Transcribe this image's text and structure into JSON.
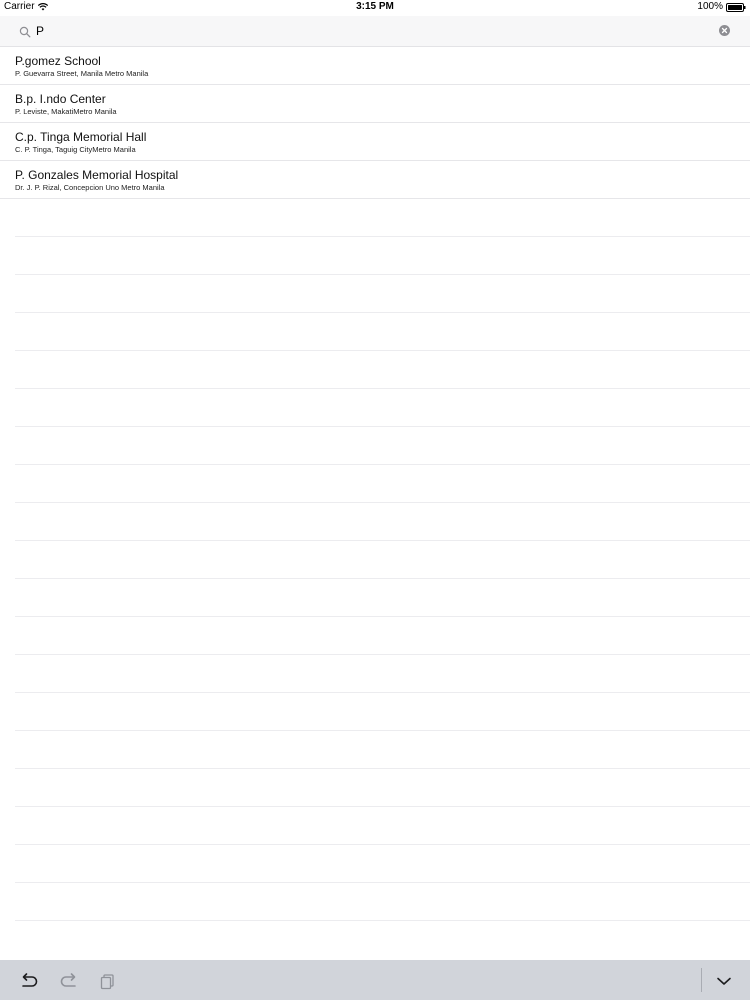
{
  "status_bar": {
    "carrier": "Carrier",
    "time": "3:15 PM",
    "battery": "100%"
  },
  "search": {
    "value": "P",
    "placeholder": ""
  },
  "results": [
    {
      "title": "P.gomez School",
      "subtitle": "P. Guevarra Street, Manila Metro Manila"
    },
    {
      "title": "B.p. I.ndo Center",
      "subtitle": "P. Leviste, MakatiMetro Manila"
    },
    {
      "title": "C.p. Tinga Memorial Hall",
      "subtitle": "C. P. Tinga, Taguig CityMetro Manila"
    },
    {
      "title": "P. Gonzales Memorial Hospital",
      "subtitle": "Dr. J. P. Rizal, Concepcion Uno Metro Manila"
    }
  ],
  "icons": {
    "wifi": "wifi-icon",
    "battery": "battery-icon",
    "search": "search-icon",
    "clear": "clear-icon",
    "undo": "undo-icon",
    "redo": "redo-icon",
    "paste": "paste-icon",
    "dismiss": "chevron-down-icon"
  },
  "colors": {
    "accessory_bar": "#d1d4da",
    "separator": "#e6e6e9"
  }
}
